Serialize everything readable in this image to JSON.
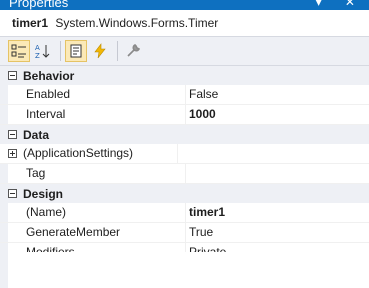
{
  "window": {
    "title": "Properties",
    "controls": "▾ ✕"
  },
  "object": {
    "name": "timer1",
    "type": "System.Windows.Forms.Timer"
  },
  "toolbar": {
    "buttons": [
      {
        "icon": "categorized-icon",
        "active": true
      },
      {
        "icon": "alphabetical-icon",
        "active": false
      },
      {
        "icon": "properties-icon",
        "active": true
      },
      {
        "icon": "events-icon",
        "active": false
      },
      {
        "icon": "property-pages-icon",
        "active": false
      }
    ]
  },
  "categories": [
    {
      "label": "Behavior",
      "rows": [
        {
          "name": "Enabled",
          "value": "False",
          "bold": false
        },
        {
          "name": "Interval",
          "value": "1000",
          "bold": true
        }
      ]
    },
    {
      "label": "Data",
      "rows": [
        {
          "name": "(ApplicationSettings)",
          "value": "",
          "bold": false,
          "expandable": true
        },
        {
          "name": "Tag",
          "value": "",
          "bold": false
        }
      ]
    },
    {
      "label": "Design",
      "rows": [
        {
          "name": "(Name)",
          "value": "timer1",
          "bold": true
        },
        {
          "name": "GenerateMember",
          "value": "True",
          "bold": false
        },
        {
          "name": "Modifiers",
          "value": "Private",
          "bold": false
        }
      ]
    }
  ]
}
